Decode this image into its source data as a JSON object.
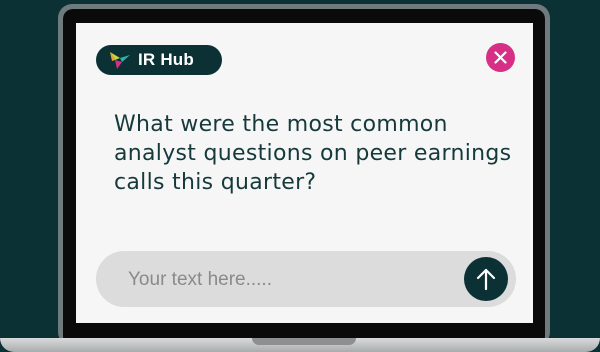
{
  "app": {
    "logo_text": "IR Hub",
    "brand_color": "#0b3135",
    "accent_color": "#d72f86"
  },
  "header": {
    "close_icon": "close-icon"
  },
  "main": {
    "question": "What were the most common analyst questions on peer earnings calls this quarter?"
  },
  "input": {
    "placeholder": "Your text here.....",
    "value": "",
    "send_icon": "arrow-up-icon"
  }
}
